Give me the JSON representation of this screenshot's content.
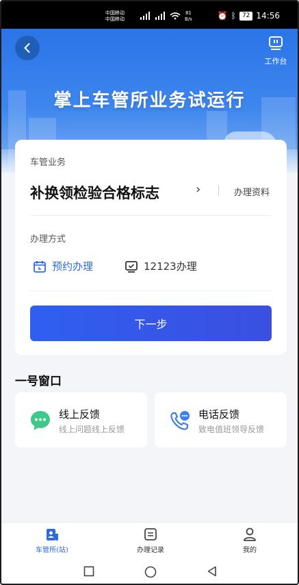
{
  "status_bar": {
    "carrier_line1": "中国移动",
    "carrier_line2": "中国移动",
    "speed_value": "81",
    "speed_unit": "B/s",
    "battery": "72",
    "time": "14:56"
  },
  "header": {
    "workbench_label": "工作台",
    "title": "掌上车管所业务试运行"
  },
  "service_card": {
    "section_label": "车管业务",
    "service_name": "补换领检验合格标志",
    "docs_link": "办理资料",
    "method_label": "办理方式",
    "method_options": [
      {
        "label": "预约办理",
        "icon": "calendar-icon",
        "selected": true
      },
      {
        "label": "12123办理",
        "icon": "monitor-check-icon",
        "selected": false
      }
    ],
    "next_button": "下一步"
  },
  "window_section": {
    "title": "一号窗口",
    "cards": [
      {
        "title": "线上反馈",
        "subtitle": "线上问题线上反馈",
        "icon": "chat-bubble-icon"
      },
      {
        "title": "电话反馈",
        "subtitle": "致电值班领导反馈",
        "icon": "phone-icon"
      }
    ]
  },
  "tabbar": {
    "tabs": [
      {
        "label": "车管所(站)",
        "icon": "station-icon",
        "active": true
      },
      {
        "label": "办理记录",
        "icon": "record-icon",
        "active": false
      },
      {
        "label": "我的",
        "icon": "user-icon",
        "active": false
      }
    ]
  },
  "colors": {
    "accent": "#2b6be0",
    "button_start": "#2f5ff0",
    "button_end": "#3b4fe0",
    "hero_top": "#2a74e8",
    "chat_green": "#3cc98a",
    "phone_blue": "#3b7fe8"
  }
}
